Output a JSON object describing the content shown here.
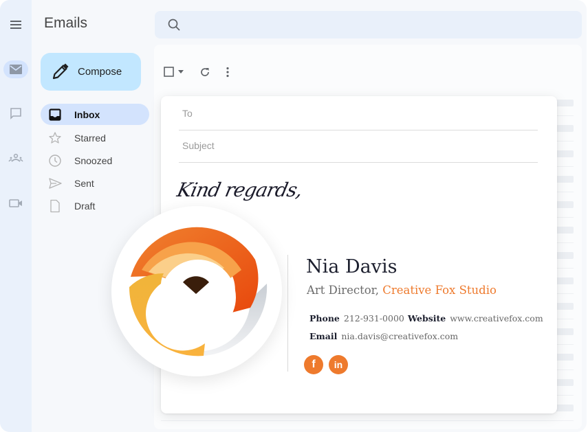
{
  "app": {
    "title": "Emails"
  },
  "rail": {
    "items": [
      {
        "name": "mail",
        "active": true
      },
      {
        "name": "chat",
        "active": false
      },
      {
        "name": "spaces",
        "active": false
      },
      {
        "name": "meet",
        "active": false
      }
    ]
  },
  "compose_button": {
    "label": "Compose"
  },
  "nav": {
    "items": [
      {
        "label": "Inbox",
        "icon": "inbox-icon",
        "active": true
      },
      {
        "label": "Starred",
        "icon": "star-icon",
        "active": false
      },
      {
        "label": "Snoozed",
        "icon": "clock-icon",
        "active": false
      },
      {
        "label": "Sent",
        "icon": "send-icon",
        "active": false
      },
      {
        "label": "Draft",
        "icon": "draft-icon",
        "active": false
      }
    ]
  },
  "search": {
    "placeholder": "",
    "value": ""
  },
  "toolbar": {
    "select_all": "checkbox",
    "refresh": "refresh-icon",
    "more": "more-vert-icon"
  },
  "compose_window": {
    "to_placeholder": "To",
    "subject_placeholder": "Subject",
    "sign_off": "Kind regards,"
  },
  "signature": {
    "name": "Nia Davis",
    "role": "Art Director,",
    "company": "Creative Fox Studio",
    "phone_label": "Phone",
    "phone": "212-931-0000",
    "website_label": "Website",
    "website": "www.creativefox.com",
    "email_label": "Email",
    "email": "nia.davis@creativefox.com",
    "socials": [
      {
        "name": "facebook",
        "glyph": "f"
      },
      {
        "name": "linkedin",
        "glyph": "in"
      }
    ],
    "accent_color": "#ee7a2d"
  }
}
